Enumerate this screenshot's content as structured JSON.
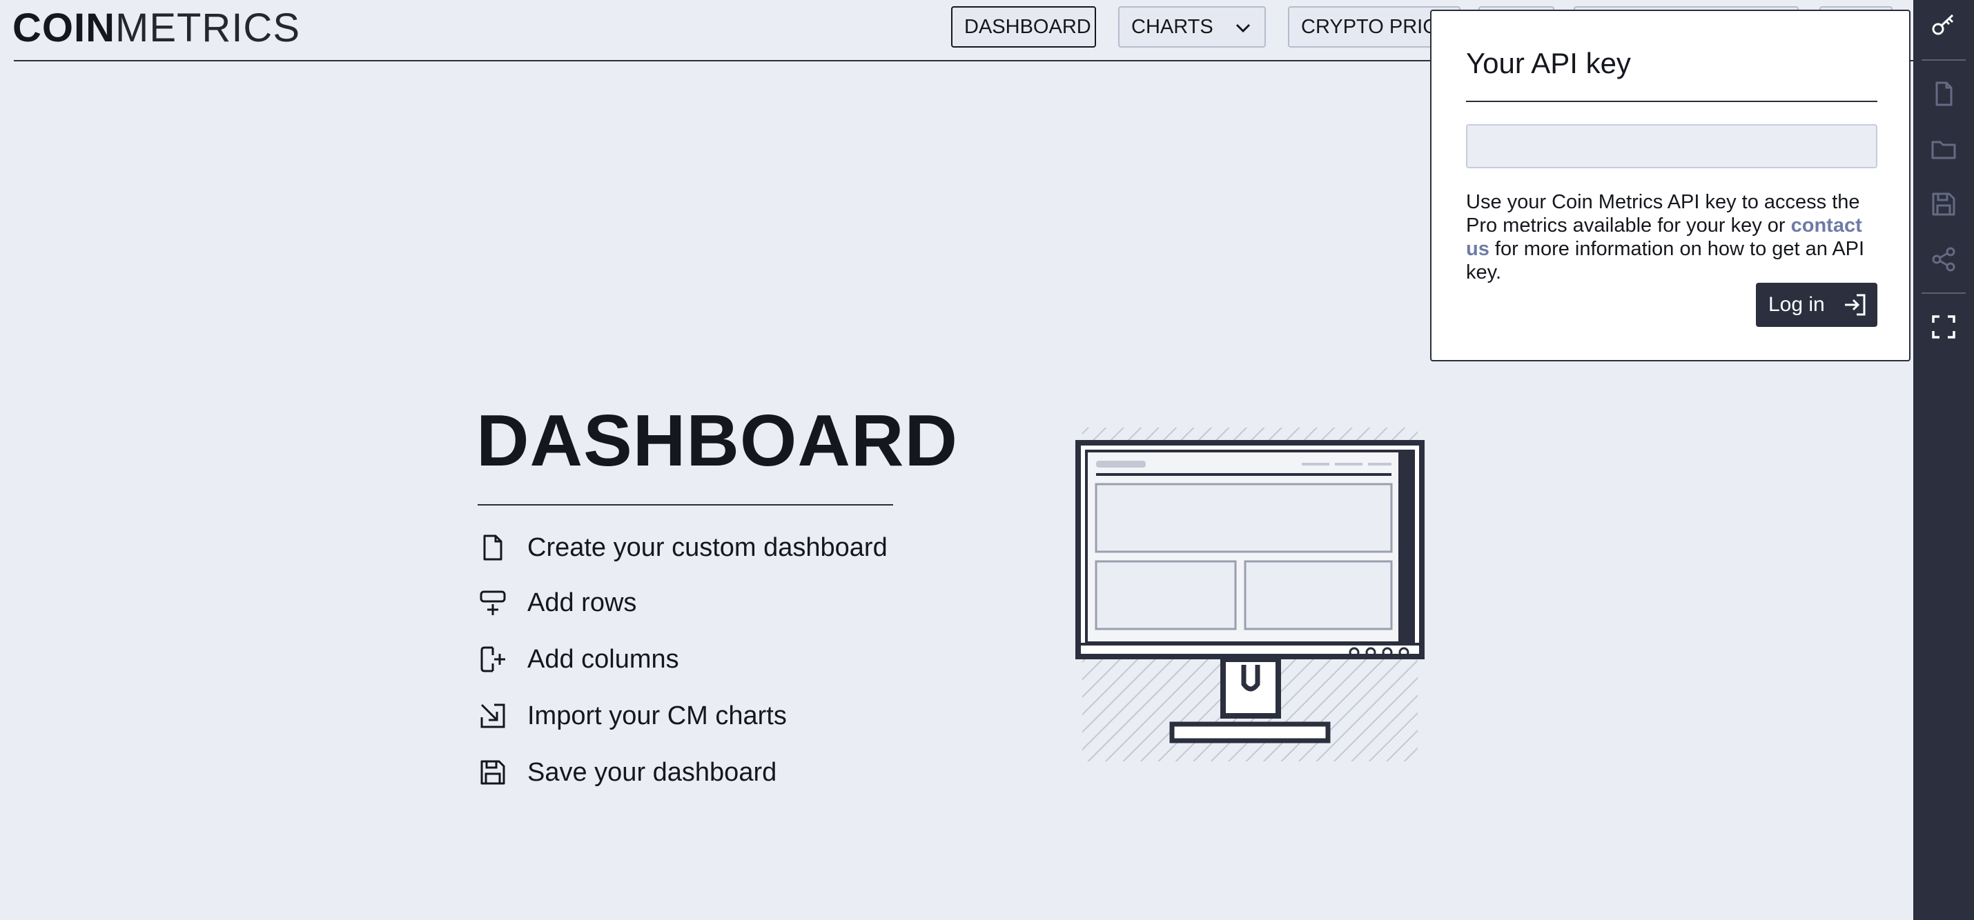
{
  "logo": {
    "strong": "COIN",
    "light": "METRICS"
  },
  "nav": {
    "items": [
      {
        "label": "DASHBOARD",
        "active": true
      },
      {
        "label": "CHARTS",
        "has_dropdown": true
      },
      {
        "label": "CRYPTO PRICES"
      },
      {
        "label": ""
      },
      {
        "label": ""
      },
      {
        "label": ""
      }
    ]
  },
  "sidebar": {
    "icons": [
      "key-icon",
      "new-file-icon",
      "folder-icon",
      "save-icon",
      "share-icon",
      "fullscreen-icon"
    ]
  },
  "api_popover": {
    "title": "Your API key",
    "input_value": "",
    "text_before": "Use your Coin Metrics API key to access the Pro metrics available for your key or ",
    "link_text": "contact us",
    "text_after": " for more information on how to get an API key.",
    "login_label": "Log in"
  },
  "main": {
    "title": "DASHBOARD",
    "features": [
      {
        "icon": "file-icon",
        "label": "Create your custom dashboard"
      },
      {
        "icon": "add-row-icon",
        "label": "Add rows"
      },
      {
        "icon": "add-column-icon",
        "label": "Add columns"
      },
      {
        "icon": "import-icon",
        "label": "Import your CM charts"
      },
      {
        "icon": "save-icon",
        "label": "Save your dashboard"
      }
    ]
  },
  "colors": {
    "background": "#eaedf4",
    "text": "#15171e",
    "sidebar": "#2b2f3e",
    "link": "#6f7ba6",
    "button": "#2b2f3e"
  }
}
